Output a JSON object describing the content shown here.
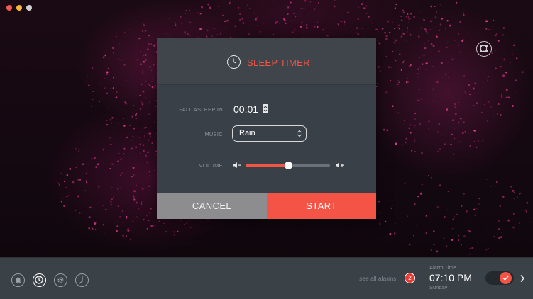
{
  "dialog": {
    "title": "SLEEP TIMER",
    "fall_asleep_label": "FALL ASLEEP IN",
    "fall_asleep_value": "00:01",
    "music_label": "MUSIC",
    "music_value": "Rain",
    "volume_label": "VOLUME",
    "volume_level": 0.5,
    "cancel_label": "CANCEL",
    "start_label": "START"
  },
  "nav": {
    "items": [
      {
        "icon": "bell-icon",
        "active": false
      },
      {
        "icon": "clock-icon",
        "active": true
      },
      {
        "icon": "gear-icon",
        "active": false
      },
      {
        "icon": "stopwatch-icon",
        "active": false
      }
    ]
  },
  "alarm": {
    "see_all_label": "see all alarms",
    "badge_count": "2",
    "caption": "Alarm Time",
    "time": "07:10 PM",
    "day": "Sunday",
    "enabled": true
  },
  "colors": {
    "accent": "#f45445",
    "dialog_bg": "#394047",
    "bar_bg": "#3a4147",
    "cancel_bg": "#8d8d8f"
  }
}
